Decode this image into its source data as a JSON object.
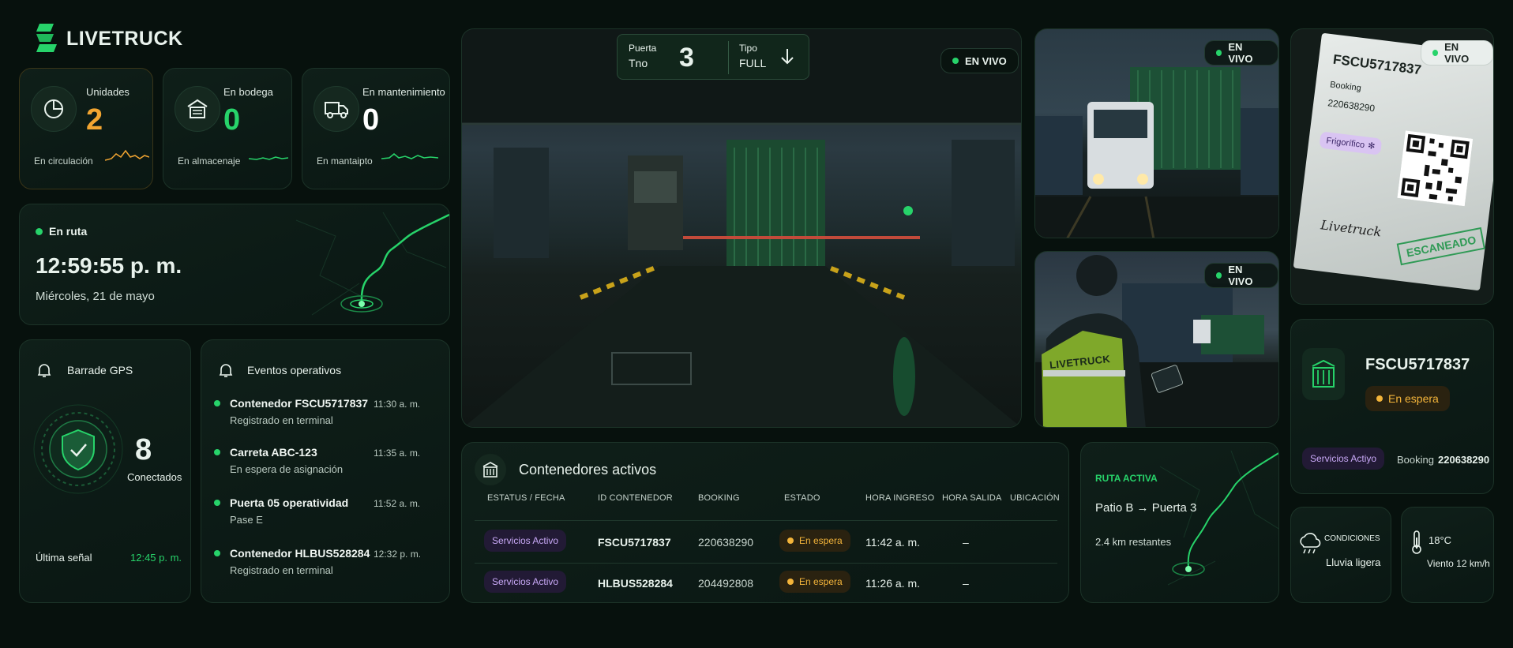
{
  "brand": {
    "name": "LIVETRUCK"
  },
  "stats": [
    {
      "label": "Unidades",
      "value": "2",
      "sub": "En circulación",
      "color": "#f2a531",
      "icon": "pie-chart-icon"
    },
    {
      "label": "En bodega",
      "value": "0",
      "sub": "En almacenaje",
      "color": "#27d36a",
      "icon": "warehouse-icon"
    },
    {
      "label": "En mantenimiento",
      "value": "0",
      "sub": "En mantaipto",
      "color": "#ffffff",
      "icon": "truck-icon"
    }
  ],
  "route": {
    "status": "En ruta",
    "time": "12:59:55 p. m.",
    "date": "Miércoles, 21 de mayo"
  },
  "gps": {
    "title": "Barrade GPS",
    "count": "8",
    "count_label": "Conectados",
    "last_label": "Última señal",
    "last_time": "12:45 p. m."
  },
  "events": {
    "title": "Eventos operativos",
    "items": [
      {
        "title": "Contenedor FSCU5717837",
        "sub": "Registrado en terminal",
        "time": "11:30 a. m."
      },
      {
        "title": "Carreta ABC-123",
        "sub": "En espera de asignación",
        "time": "11:35 a. m."
      },
      {
        "title": "Puerta 05 operatividad",
        "sub": "Pase E",
        "time": "11:52 a. m."
      },
      {
        "title": "Contenedor HLBUS528284",
        "sub": "Registrado en terminal",
        "time": "12:32 p. m."
      }
    ]
  },
  "gate_cam": {
    "puerta_label": "Puerta",
    "puerta_sub": "Tno",
    "puerta_num": "3",
    "tipo_label": "Tipo",
    "tipo_value": "FULL",
    "live": "EN VIVO"
  },
  "cam2": {
    "live": "EN VIVO"
  },
  "cam3": {
    "live": "EN VIVO",
    "vest_text": "LIVETRUCK"
  },
  "doc": {
    "live": "EN VIVO",
    "container": "FSCU5717837",
    "booking_label": "Booking",
    "booking": "220638290",
    "tag": "Frigorífico",
    "stamp": "ESCANEADO",
    "signature": "Livetruck"
  },
  "containers": {
    "title": "Contenedores activos",
    "headers": [
      "ESTATUS / FECHA",
      "ID CONTENEDOR",
      "BOOKING",
      "ESTADO",
      "HORA INGRESO",
      "HORA SALIDA",
      "UBICACIÓN"
    ],
    "rows": [
      {
        "status": "Servicios Activo",
        "id": "FSCU5717837",
        "booking": "220638290",
        "estado": "En espera",
        "ingreso": "11:42 a. m.",
        "salida": "–"
      },
      {
        "status": "Servicios Activo",
        "id": "HLBUS528284",
        "booking": "204492808",
        "estado": "En espera",
        "ingreso": "11:26 a. m.",
        "salida": "–"
      }
    ]
  },
  "active_route": {
    "title": "RUTA ACTIVA",
    "path": "Patio B → Puerta 3",
    "remaining": "2.4 km restantes"
  },
  "detail": {
    "id": "FSCU5717837",
    "status": "En espera",
    "service": "Servicios Actiyo",
    "booking_label": "Booking",
    "booking": "220638290"
  },
  "weather": {
    "cond_label": "CONDICIONES",
    "cond_value": "Lluvia ligera",
    "temp": "18°C",
    "wind": "Viento 12 km/h"
  },
  "colors": {
    "accent": "#27d36a",
    "warning": "#f3b43a",
    "purple": "#c8a8f6",
    "bg": "#07110d"
  }
}
